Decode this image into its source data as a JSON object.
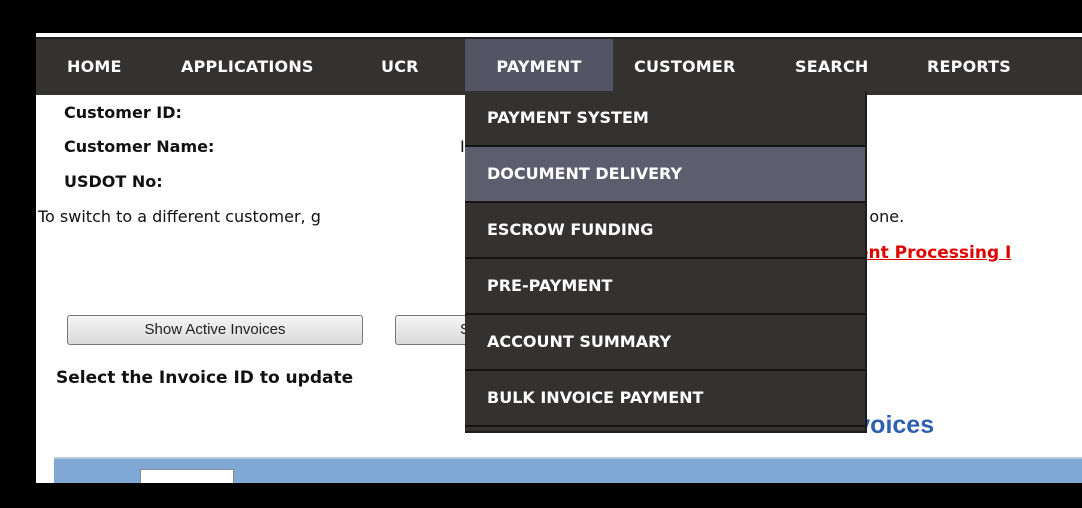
{
  "nav": {
    "items": [
      {
        "label": "HOME"
      },
      {
        "label": "APPLICATIONS"
      },
      {
        "label": "UCR"
      },
      {
        "label": "PAYMENT"
      },
      {
        "label": "CUSTOMER"
      },
      {
        "label": "SEARCH"
      },
      {
        "label": "REPORTS"
      }
    ],
    "active": "PAYMENT"
  },
  "customer": {
    "id_label": "Customer ID:",
    "name_label": "Customer Name:",
    "usdot_label": "USDOT No:",
    "name_value_fragment": "I",
    "switch_text_left": "To switch to a different customer, g",
    "switch_text_right": "t one."
  },
  "links": {
    "processing_fragment": "ent Processing I"
  },
  "buttons": {
    "show_active": "Show Active Invoices",
    "second_fragment": "S"
  },
  "select_prompt": "Select the Invoice ID to update",
  "heading_fragment": "nvoices",
  "payment_menu": {
    "items": [
      {
        "label": "PAYMENT SYSTEM"
      },
      {
        "label": "DOCUMENT DELIVERY"
      },
      {
        "label": "ESCROW FUNDING"
      },
      {
        "label": "PRE-PAYMENT"
      },
      {
        "label": "ACCOUNT SUMMARY"
      },
      {
        "label": "BULK INVOICE PAYMENT"
      }
    ],
    "hovered": "DOCUMENT DELIVERY"
  },
  "colors": {
    "nav_bg": "#343131",
    "nav_active": "#545564",
    "menu_hover": "#5d5d6e",
    "link_red": "#e00000",
    "heading_blue": "#2e5fb0",
    "grid_header": "#7fa8d4"
  }
}
